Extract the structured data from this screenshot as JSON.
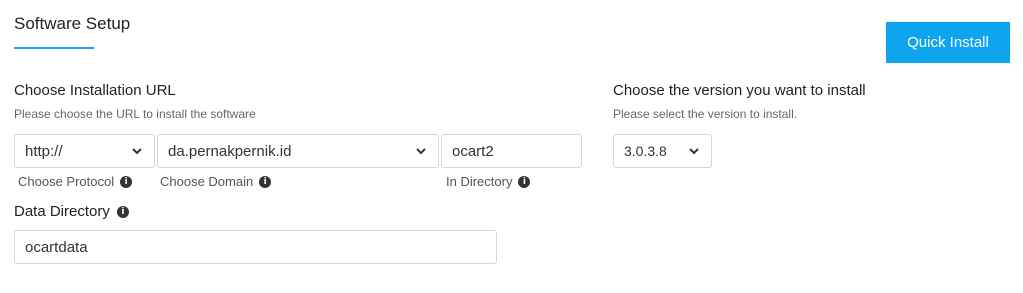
{
  "header": {
    "title": "Software Setup",
    "quick_install_label": "Quick Install"
  },
  "install_url": {
    "heading": "Choose Installation URL",
    "subheading": "Please choose the URL to install the software",
    "protocol": {
      "value": "http://",
      "label": "Choose Protocol"
    },
    "domain": {
      "value": "da.pernakpernik.id",
      "label": "Choose Domain"
    },
    "directory": {
      "value": "ocart2",
      "label": "In Directory"
    }
  },
  "data_directory": {
    "label": "Data Directory",
    "value": "ocartdata"
  },
  "version": {
    "heading": "Choose the version you want to install",
    "subheading": "Please select the version to install.",
    "value": "3.0.3.8"
  },
  "icons": {
    "info": "info-icon",
    "dropdown": "chevron-down-icon"
  },
  "colors": {
    "accent": "#0ea5ef",
    "underline": "#1e9ff2"
  }
}
